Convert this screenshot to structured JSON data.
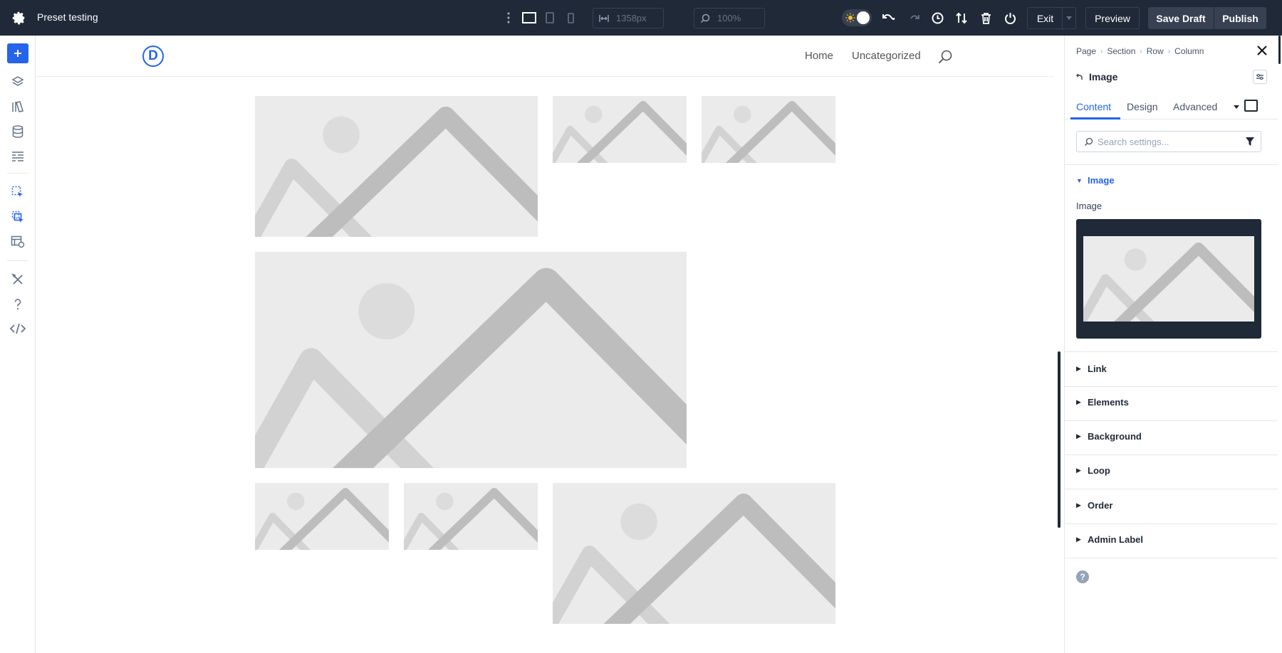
{
  "topbar": {
    "title": "Preset testing",
    "width_value": "1358px",
    "zoom_value": "100%",
    "exit_label": "Exit",
    "preview_label": "Preview",
    "save_label": "Save Draft",
    "publish_label": "Publish"
  },
  "site": {
    "logo_letter": "D",
    "nav": [
      "Home",
      "Uncategorized"
    ]
  },
  "panel": {
    "breadcrumb": [
      "Page",
      "Section",
      "Row",
      "Column"
    ],
    "element_title": "Image",
    "tabs": [
      "Content",
      "Design",
      "Advanced"
    ],
    "active_tab": "Content",
    "search_placeholder": "Search settings...",
    "open_section": "Image",
    "field_label": "Image",
    "sections": [
      "Link",
      "Elements",
      "Background",
      "Loop",
      "Order",
      "Admin Label"
    ],
    "help_symbol": "?"
  },
  "colors": {
    "topbar_bg": "#1f2937",
    "accent": "#2563eb",
    "placeholder_bg": "#ebebeb",
    "placeholder_mark": "#bdbdbd"
  }
}
